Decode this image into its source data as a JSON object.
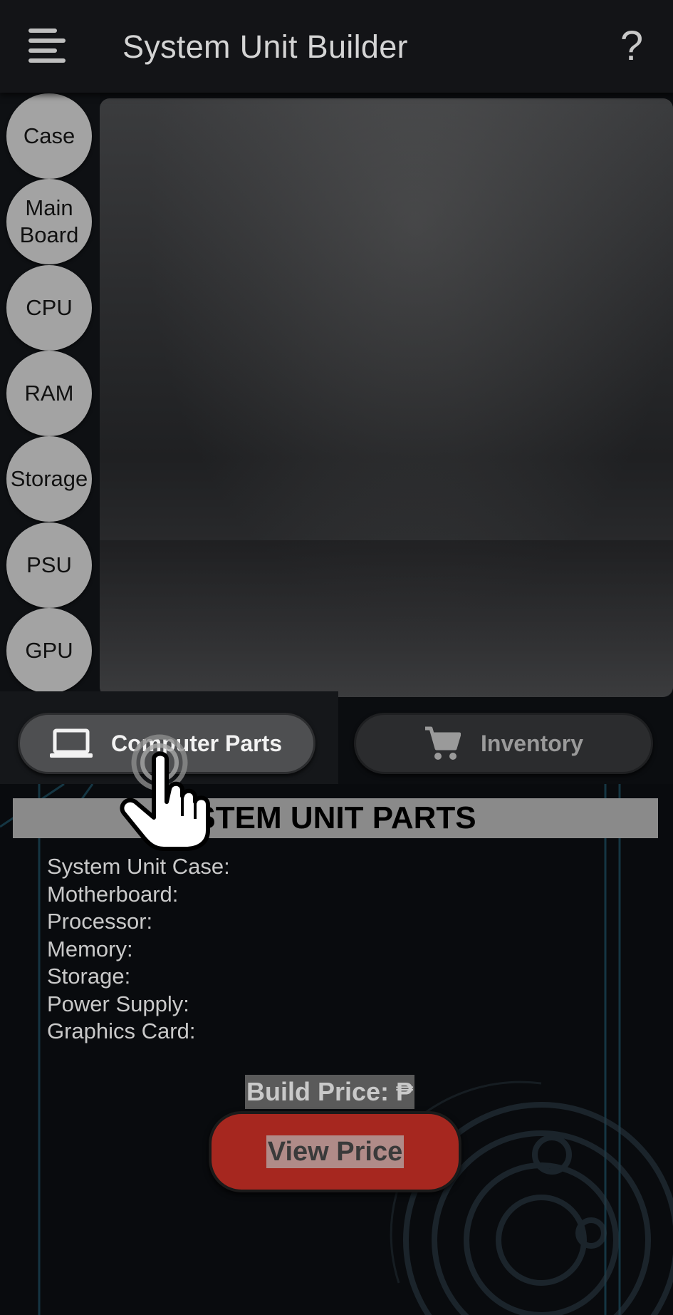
{
  "appbar": {
    "title": "System Unit Builder",
    "help_label": "?"
  },
  "categories": [
    {
      "label": "Case"
    },
    {
      "label": "Main\nBoard"
    },
    {
      "label": "CPU"
    },
    {
      "label": "RAM"
    },
    {
      "label": "Storage"
    },
    {
      "label": "PSU"
    },
    {
      "label": "GPU"
    }
  ],
  "tabs": {
    "parts": {
      "label": "Computer Parts",
      "icon": "laptop-icon",
      "selected": true
    },
    "inventory": {
      "label": "Inventory",
      "icon": "cart-icon",
      "selected": false
    }
  },
  "parts_panel": {
    "title": "STEM UNIT PARTS",
    "rows": [
      "System Unit Case:",
      "Motherboard:",
      "Processor:",
      "Memory:",
      "Storage:",
      "Power Supply:",
      "Graphics Card:"
    ],
    "build_price_label": "Build Price: ₱",
    "view_price_label": "View Price"
  },
  "colors": {
    "accent_red": "#a6271f",
    "category_button": "#a3a3a3",
    "tech_line_blue": "#2a6f8a"
  }
}
